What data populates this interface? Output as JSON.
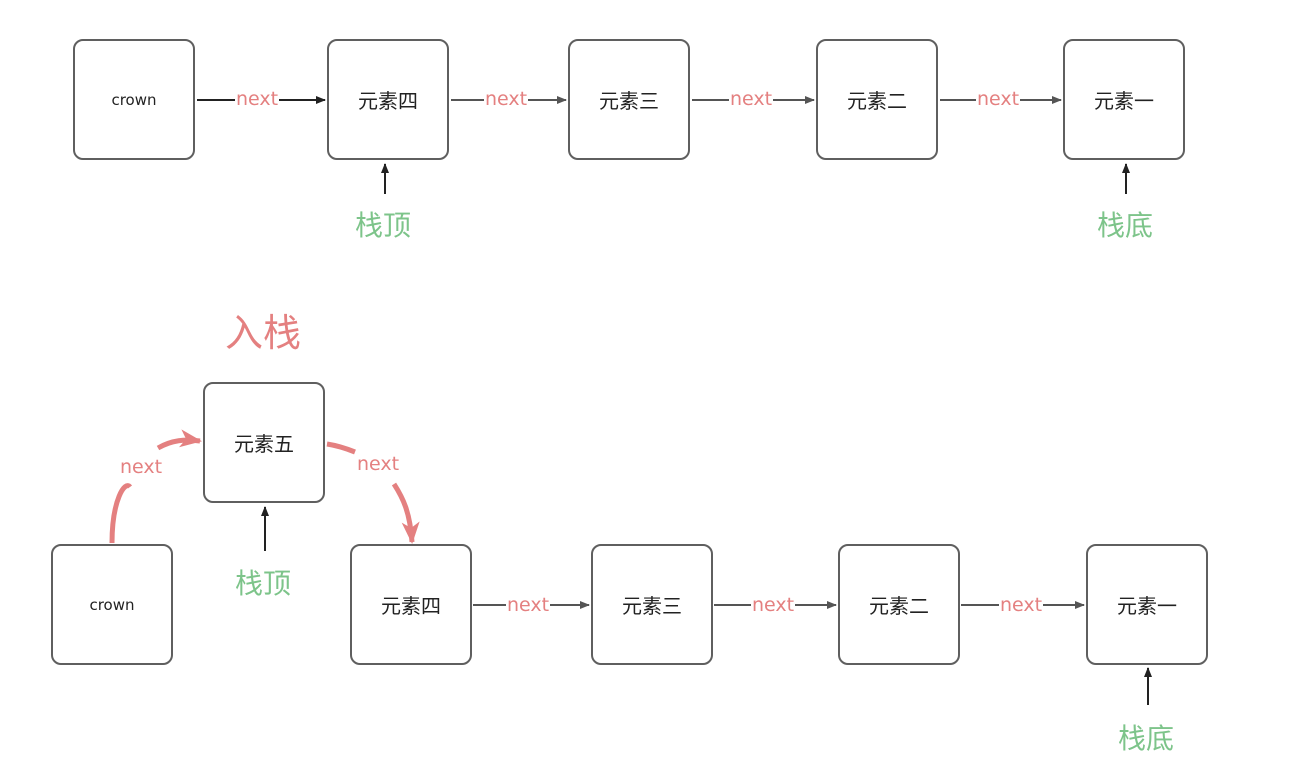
{
  "top_row": {
    "nodes": [
      "crown",
      "元素四",
      "元素三",
      "元素二",
      "元素一"
    ],
    "edge_label": "next",
    "top_pointer": "栈顶",
    "bottom_pointer": "栈底"
  },
  "bottom_row": {
    "title": "入栈",
    "new_node": "元素五",
    "nodes": [
      "crown",
      "元素四",
      "元素三",
      "元素二",
      "元素一"
    ],
    "edge_label": "next",
    "top_pointer": "栈顶",
    "bottom_pointer": "栈底"
  },
  "colors": {
    "edge_label": "#e48080",
    "pointer_label": "#7dc48a",
    "box_border": "#5f5f5f",
    "push_arrow": "#e48080"
  }
}
